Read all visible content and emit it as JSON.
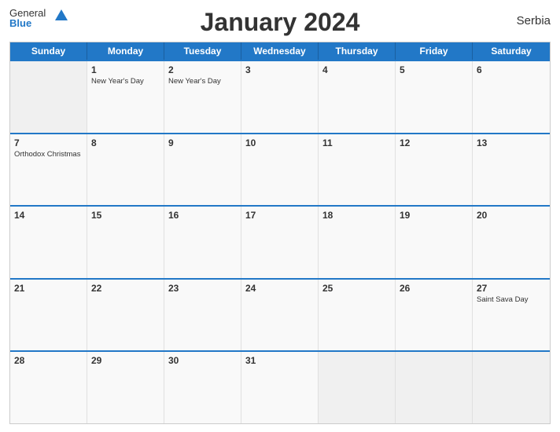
{
  "header": {
    "title": "January 2024",
    "country": "Serbia",
    "logo_general": "General",
    "logo_blue": "Blue"
  },
  "calendar": {
    "days_of_week": [
      "Sunday",
      "Monday",
      "Tuesday",
      "Wednesday",
      "Thursday",
      "Friday",
      "Saturday"
    ],
    "weeks": [
      [
        {
          "day": "",
          "events": []
        },
        {
          "day": "1",
          "events": [
            "New Year's Day"
          ]
        },
        {
          "day": "2",
          "events": [
            "New Year's Day"
          ]
        },
        {
          "day": "3",
          "events": []
        },
        {
          "day": "4",
          "events": []
        },
        {
          "day": "5",
          "events": []
        },
        {
          "day": "6",
          "events": []
        }
      ],
      [
        {
          "day": "7",
          "events": [
            "Orthodox Christmas"
          ]
        },
        {
          "day": "8",
          "events": []
        },
        {
          "day": "9",
          "events": []
        },
        {
          "day": "10",
          "events": []
        },
        {
          "day": "11",
          "events": []
        },
        {
          "day": "12",
          "events": []
        },
        {
          "day": "13",
          "events": []
        }
      ],
      [
        {
          "day": "14",
          "events": []
        },
        {
          "day": "15",
          "events": []
        },
        {
          "day": "16",
          "events": []
        },
        {
          "day": "17",
          "events": []
        },
        {
          "day": "18",
          "events": []
        },
        {
          "day": "19",
          "events": []
        },
        {
          "day": "20",
          "events": []
        }
      ],
      [
        {
          "day": "21",
          "events": []
        },
        {
          "day": "22",
          "events": []
        },
        {
          "day": "23",
          "events": []
        },
        {
          "day": "24",
          "events": []
        },
        {
          "day": "25",
          "events": []
        },
        {
          "day": "26",
          "events": []
        },
        {
          "day": "27",
          "events": [
            "Saint Sava Day"
          ]
        }
      ],
      [
        {
          "day": "28",
          "events": []
        },
        {
          "day": "29",
          "events": []
        },
        {
          "day": "30",
          "events": []
        },
        {
          "day": "31",
          "events": []
        },
        {
          "day": "",
          "events": []
        },
        {
          "day": "",
          "events": []
        },
        {
          "day": "",
          "events": []
        }
      ]
    ]
  }
}
